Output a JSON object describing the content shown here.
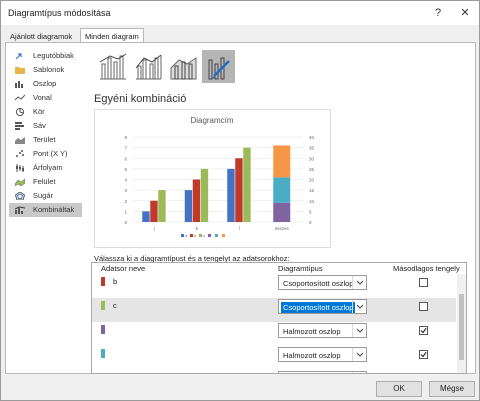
{
  "window": {
    "title": "Diagramtípus módosítása",
    "help_glyph": "?",
    "close_glyph": "✕"
  },
  "tabs": [
    {
      "label": "Ajánlott diagramok"
    },
    {
      "label": "Minden diagram"
    }
  ],
  "sidebar": {
    "items": [
      {
        "label": "Legutóbbiak",
        "icon": "recent-icon"
      },
      {
        "label": "Sablonok",
        "icon": "templates-folder-icon"
      },
      {
        "label": "Oszlop",
        "icon": "column-chart-icon"
      },
      {
        "label": "Vonal",
        "icon": "line-chart-icon"
      },
      {
        "label": "Kör",
        "icon": "pie-chart-icon"
      },
      {
        "label": "Sáv",
        "icon": "bar-chart-icon"
      },
      {
        "label": "Terület",
        "icon": "area-chart-icon"
      },
      {
        "label": "Pont (X Y)",
        "icon": "scatter-chart-icon"
      },
      {
        "label": "Árfolyam",
        "icon": "stock-chart-icon"
      },
      {
        "label": "Felület",
        "icon": "surface-chart-icon"
      },
      {
        "label": "Sugár",
        "icon": "radar-chart-icon"
      },
      {
        "label": "Kombináltak",
        "icon": "combo-chart-icon"
      }
    ],
    "selected": "Kombináltak"
  },
  "subtypes": [
    "clustered-column-line-icon",
    "clustered-column-line-secondary-icon",
    "stacked-area-clustered-column-icon",
    "custom-combination-icon"
  ],
  "section_title": "Egyéni kombináció",
  "chart_data": {
    "type": "bar",
    "title": "Diagramcím",
    "categories": [
      "j",
      "k",
      "l",
      "összes"
    ],
    "primary_ylim": [
      0,
      8
    ],
    "primary_ticks": [
      "0",
      "1",
      "2",
      "3",
      "4",
      "5",
      "6",
      "7",
      "8"
    ],
    "secondary_ylim": [
      0,
      40
    ],
    "secondary_ticks": [
      "0",
      "5",
      "10",
      "15",
      "20",
      "25",
      "30",
      "35",
      "40"
    ],
    "series": [
      {
        "name": "a",
        "axis": "primary",
        "kind": "clustered",
        "color": "#4472c4",
        "values": [
          1,
          3,
          5,
          null
        ]
      },
      {
        "name": "b",
        "axis": "primary",
        "kind": "clustered",
        "color": "#c0392b",
        "values": [
          2,
          4,
          6,
          null
        ]
      },
      {
        "name": "c",
        "axis": "primary",
        "kind": "clustered",
        "color": "#9bbb59",
        "values": [
          3,
          5,
          7,
          null
        ]
      },
      {
        "name": "",
        "axis": "secondary",
        "kind": "stacked",
        "color": "#8064a2",
        "values": [
          null,
          null,
          null,
          9
        ]
      },
      {
        "name": "",
        "axis": "secondary",
        "kind": "stacked",
        "color": "#4bacc6",
        "values": [
          null,
          null,
          null,
          12
        ]
      },
      {
        "name": "",
        "axis": "secondary",
        "kind": "stacked",
        "color": "#f79646",
        "values": [
          null,
          null,
          null,
          15
        ]
      }
    ],
    "legend_position": "bottom"
  },
  "series_grid": {
    "instruction": "Válassza ki a diagramtípust és a tengelyt az adatsorokhoz:",
    "headers": {
      "name": "Adatsor neve",
      "type": "Diagramtípus",
      "secondary": "Másodlagos tengely"
    },
    "rows": [
      {
        "name": "b",
        "color": "#c0392b",
        "type": "Csoportosított oszlop",
        "secondary": false,
        "selected": false
      },
      {
        "name": "c",
        "color": "#9bbb59",
        "type": "Csoportosított oszlop",
        "secondary": false,
        "selected": true
      },
      {
        "name": "",
        "color": "#8064a2",
        "type": "Halmozott oszlop",
        "secondary": true,
        "selected": false
      },
      {
        "name": "",
        "color": "#4bacc6",
        "type": "Halmozott oszlop",
        "secondary": true,
        "selected": false
      },
      {
        "name": "",
        "color": "#f79646",
        "type": "Halmozott oszlop",
        "secondary": true,
        "selected": false
      }
    ]
  },
  "buttons": {
    "ok": "OK",
    "cancel": "Mégse"
  }
}
